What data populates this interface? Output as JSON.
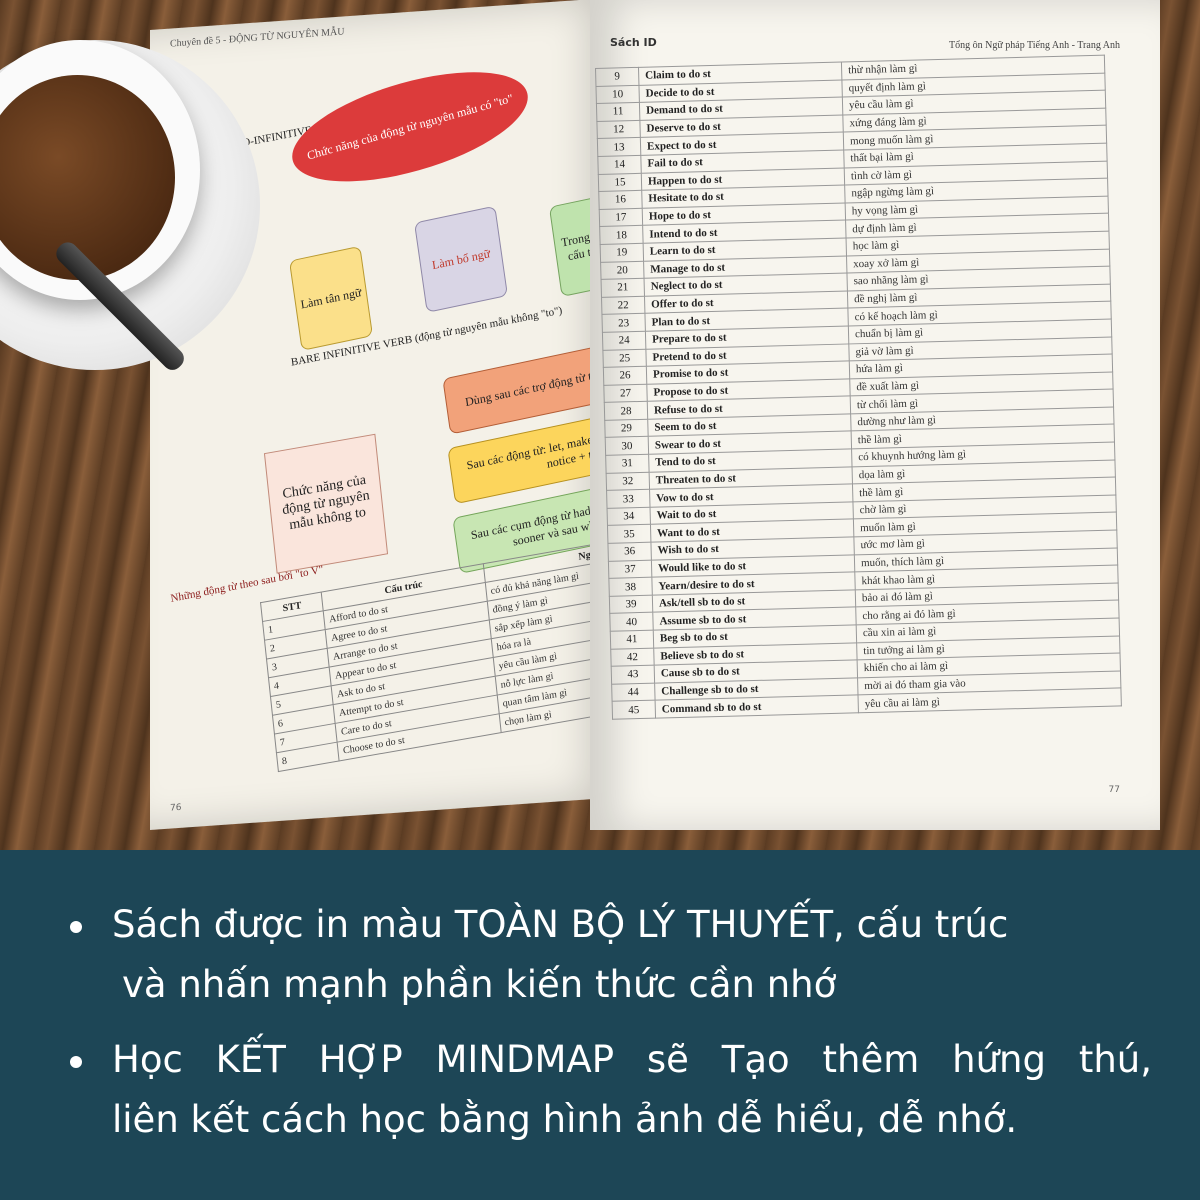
{
  "left_page": {
    "header": "Chuyên đề 5 - ĐỘNG TỪ NGUYÊN MẪU",
    "section1_label": "TO-INFINITIVE VERB (động từ nguyên mẫu có \"to\")",
    "mindmap1": {
      "center": "Chức năng của động từ nguyên mẫu có \"to\"",
      "branches": [
        "Làm tân ngữ",
        "Làm bổ ngữ",
        "Trong các cấu trúc"
      ]
    },
    "section2_label": "BARE INFINITIVE VERB (động từ nguyên mẫu không \"to\")",
    "mindmap2": {
      "center": "Chức năng của động từ nguyên mẫu không to",
      "branches": [
        "Dùng sau các trợ động từ tình thái (modal verbs)",
        "Sau các động từ: let, make, help, see, hear, watch, notice + tân ngữ.",
        "Sau các cụm động từ had better, would rather, had sooner và sau why hoặc why not."
      ]
    },
    "table_title": "Những động từ theo sau bởi \"to V\"",
    "table_headers": [
      "STT",
      "Cấu trúc",
      "Nghĩa"
    ],
    "table_rows": [
      [
        "1",
        "Afford to do st",
        "có đủ khả năng làm gì"
      ],
      [
        "2",
        "Agree to do st",
        "đồng ý làm gì"
      ],
      [
        "3",
        "Arrange to do st",
        "sắp xếp làm gì"
      ],
      [
        "4",
        "Appear to do st",
        "hóa ra là"
      ],
      [
        "5",
        "Ask to do st",
        "yêu cầu làm gì"
      ],
      [
        "6",
        "Attempt to do st",
        "nỗ lực làm gì"
      ],
      [
        "7",
        "Care to do st",
        "quan tâm làm gì"
      ],
      [
        "8",
        "Choose to do st",
        "chọn làm gì"
      ]
    ],
    "page_number": "76"
  },
  "right_page": {
    "book_id": "Sách ID",
    "header": "Tổng ôn Ngữ pháp Tiếng Anh - Trang Anh",
    "rows": [
      [
        "9",
        "Claim to do st",
        "thừ nhận làm gì"
      ],
      [
        "10",
        "Decide to do st",
        "quyết định làm gì"
      ],
      [
        "11",
        "Demand to do st",
        "yêu cầu làm gì"
      ],
      [
        "12",
        "Deserve to do st",
        "xứng đáng làm gì"
      ],
      [
        "13",
        "Expect to do st",
        "mong muốn làm gì"
      ],
      [
        "14",
        "Fail to do st",
        "thất bại làm gì"
      ],
      [
        "15",
        "Happen to do st",
        "tình cờ làm gì"
      ],
      [
        "16",
        "Hesitate to do st",
        "ngập ngừng làm gì"
      ],
      [
        "17",
        "Hope to do st",
        "hy vọng làm gì"
      ],
      [
        "18",
        "Intend to do st",
        "dự định làm gì"
      ],
      [
        "19",
        "Learn to do st",
        "học làm gì"
      ],
      [
        "20",
        "Manage to do st",
        "xoay xở làm gì"
      ],
      [
        "21",
        "Neglect to do st",
        "sao nhãng làm gì"
      ],
      [
        "22",
        "Offer to do st",
        "đề nghị làm gì"
      ],
      [
        "23",
        "Plan to do st",
        "có kế hoạch làm gì"
      ],
      [
        "24",
        "Prepare to do st",
        "chuẩn bị làm gì"
      ],
      [
        "25",
        "Pretend to do st",
        "giả vờ làm gì"
      ],
      [
        "26",
        "Promise to do st",
        "hứa làm gì"
      ],
      [
        "27",
        "Propose to do st",
        "đề xuất làm gì"
      ],
      [
        "28",
        "Refuse to do st",
        "từ chối làm gì"
      ],
      [
        "29",
        "Seem to do st",
        "dường như làm gì"
      ],
      [
        "30",
        "Swear to do st",
        "thề làm gì"
      ],
      [
        "31",
        "Tend to do st",
        "có khuynh hướng làm gì"
      ],
      [
        "32",
        "Threaten to do st",
        "dọa làm gì"
      ],
      [
        "33",
        "Vow to do st",
        "thề làm gì"
      ],
      [
        "34",
        "Wait to do st",
        "chờ làm gì"
      ],
      [
        "35",
        "Want to do st",
        "muốn làm gì"
      ],
      [
        "36",
        "Wish to do st",
        "ước mơ làm gì"
      ],
      [
        "37",
        "Would like to do st",
        "muốn, thích làm gì"
      ],
      [
        "38",
        "Yearn/desire to do st",
        "khát khao làm gì"
      ],
      [
        "39",
        "Ask/tell sb to do st",
        "bảo ai đó làm gì"
      ],
      [
        "40",
        "Assume sb to do st",
        "cho rằng ai đó làm gì"
      ],
      [
        "41",
        "Beg sb to do st",
        "cầu xin ai làm gì"
      ],
      [
        "42",
        "Believe sb to do st",
        "tin tưởng ai làm gì"
      ],
      [
        "43",
        "Cause sb to do st",
        "khiến cho ai làm gì"
      ],
      [
        "44",
        "Challenge sb to do st",
        "mời ai đó tham gia vào"
      ],
      [
        "45",
        "Command sb to do st",
        "yêu cầu ai làm gì"
      ]
    ],
    "page_number": "77"
  },
  "caption": {
    "bullet1_line1": "Sách được in màu TOÀN BỘ LÝ THUYẾT, cấu trúc",
    "bullet1_line2": "và nhấn mạnh phần kiến thức cần nhớ",
    "bullet2_line1": "Học KẾT HỢP MINDMAP sẽ Tạo thêm hứng thú,",
    "bullet2_line2": "liên kết cách học bằng hình ảnh dễ hiểu, dễ nhớ."
  },
  "colors": {
    "caption_bg": "#1d4656",
    "caption_text": "#ffffff"
  }
}
